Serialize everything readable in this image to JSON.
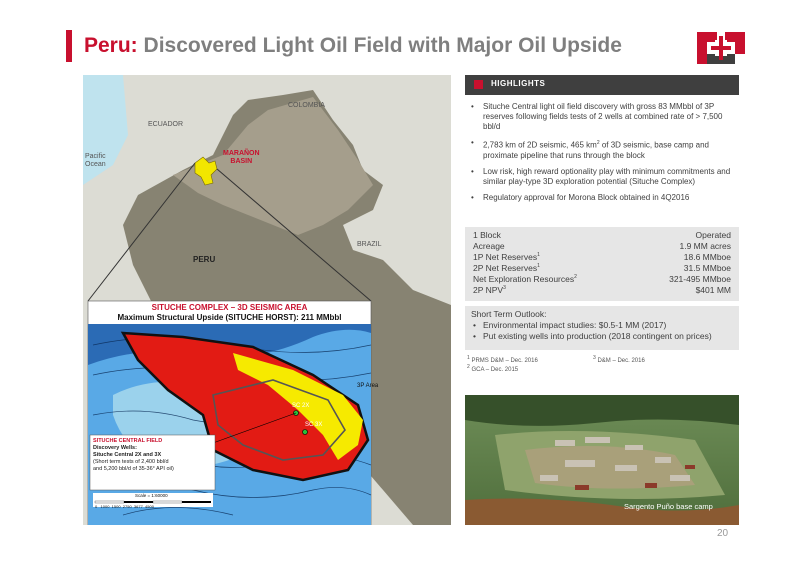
{
  "title": {
    "prefix": "Peru:",
    "rest": "Discovered Light Oil Field with Major Oil Upside"
  },
  "map": {
    "labels": {
      "ecuador": "ECUADOR",
      "colombia": "COLOMBIA",
      "pacific": "Pacific\nOcean",
      "maranon": "MARAÑON\nBASIN",
      "brazil": "BRAZIL",
      "peru": "PERU"
    },
    "inset_title": "SITUCHE COMPLEX – 3D SEISMIC AREA",
    "inset_subtitle": "Maximum Structural Upside (SITUCHE HORST): 211 MMbbl",
    "area_label": "3P Area",
    "well_labels": [
      "SC 2X",
      "SC 3X"
    ],
    "field_box": {
      "title": "SITUCHE CENTRAL FIELD",
      "line1": "Discovery Wells:",
      "line2": "Situche Central 2X and 3X",
      "line3": "(Short term tests of 2,400 bbl/d",
      "line4": "and 5,200 bbl/d of 35-36° API oil)"
    },
    "scale": {
      "label": "Scale = 1:60000",
      "ticks": "0   1000  1500  2750  3677  4500"
    }
  },
  "highlights": {
    "heading": "HIGHLIGHTS",
    "b1": "Situche Central light oil field discovery with gross 83 MMbbl of 3P reserves following fields tests of 2 wells at combined rate of > 7,500 bbl/d",
    "b2_pre": "2,783 km of 2D seismic, 465 km",
    "b2_sup": "2",
    "b2_post": " of 3D seismic, base camp and proximate pipeline that runs through the block",
    "b3": "Low risk, high reward optionality play with minimum commitments and similar play-type 3D exploration potential (Situche Complex)",
    "b4": "Regulatory approval for Morona Block obtained in 4Q2016"
  },
  "metrics": [
    {
      "label": "1 Block",
      "sup": "",
      "value": "Operated"
    },
    {
      "label": "Acreage",
      "sup": "",
      "value": "1.9 MM acres"
    },
    {
      "label": "1P Net Reserves",
      "sup": "1",
      "value": "18.6 MMboe"
    },
    {
      "label": "2P Net Reserves",
      "sup": "1",
      "value": "31.5 MMboe"
    },
    {
      "label": "Net Exploration Resources",
      "sup": "2",
      "value": "321-495 MMboe"
    },
    {
      "label": "2P NPV",
      "sup": "3",
      "value": "$401 MM"
    }
  ],
  "short_term": {
    "title": "Short Term Outlook:",
    "items": [
      "Environmental impact studies: $0.5-1 MM (2017)",
      "Put existing wells into production (2018 contingent on prices)"
    ]
  },
  "footnotes": {
    "f1": "PRMS D&M – Dec. 2016",
    "f1n": "1",
    "f2": "GCA – Dec. 2015",
    "f2n": "2",
    "f3": "D&M – Dec. 2016",
    "f3n": "3"
  },
  "photo_caption": "Sargento Puño base camp",
  "page_number": "20",
  "colors": {
    "brand_red": "#c8102e",
    "title_gray": "#7f7f7f",
    "header_dark": "#3f3f3f",
    "panel_gray": "#e6e6e6"
  }
}
